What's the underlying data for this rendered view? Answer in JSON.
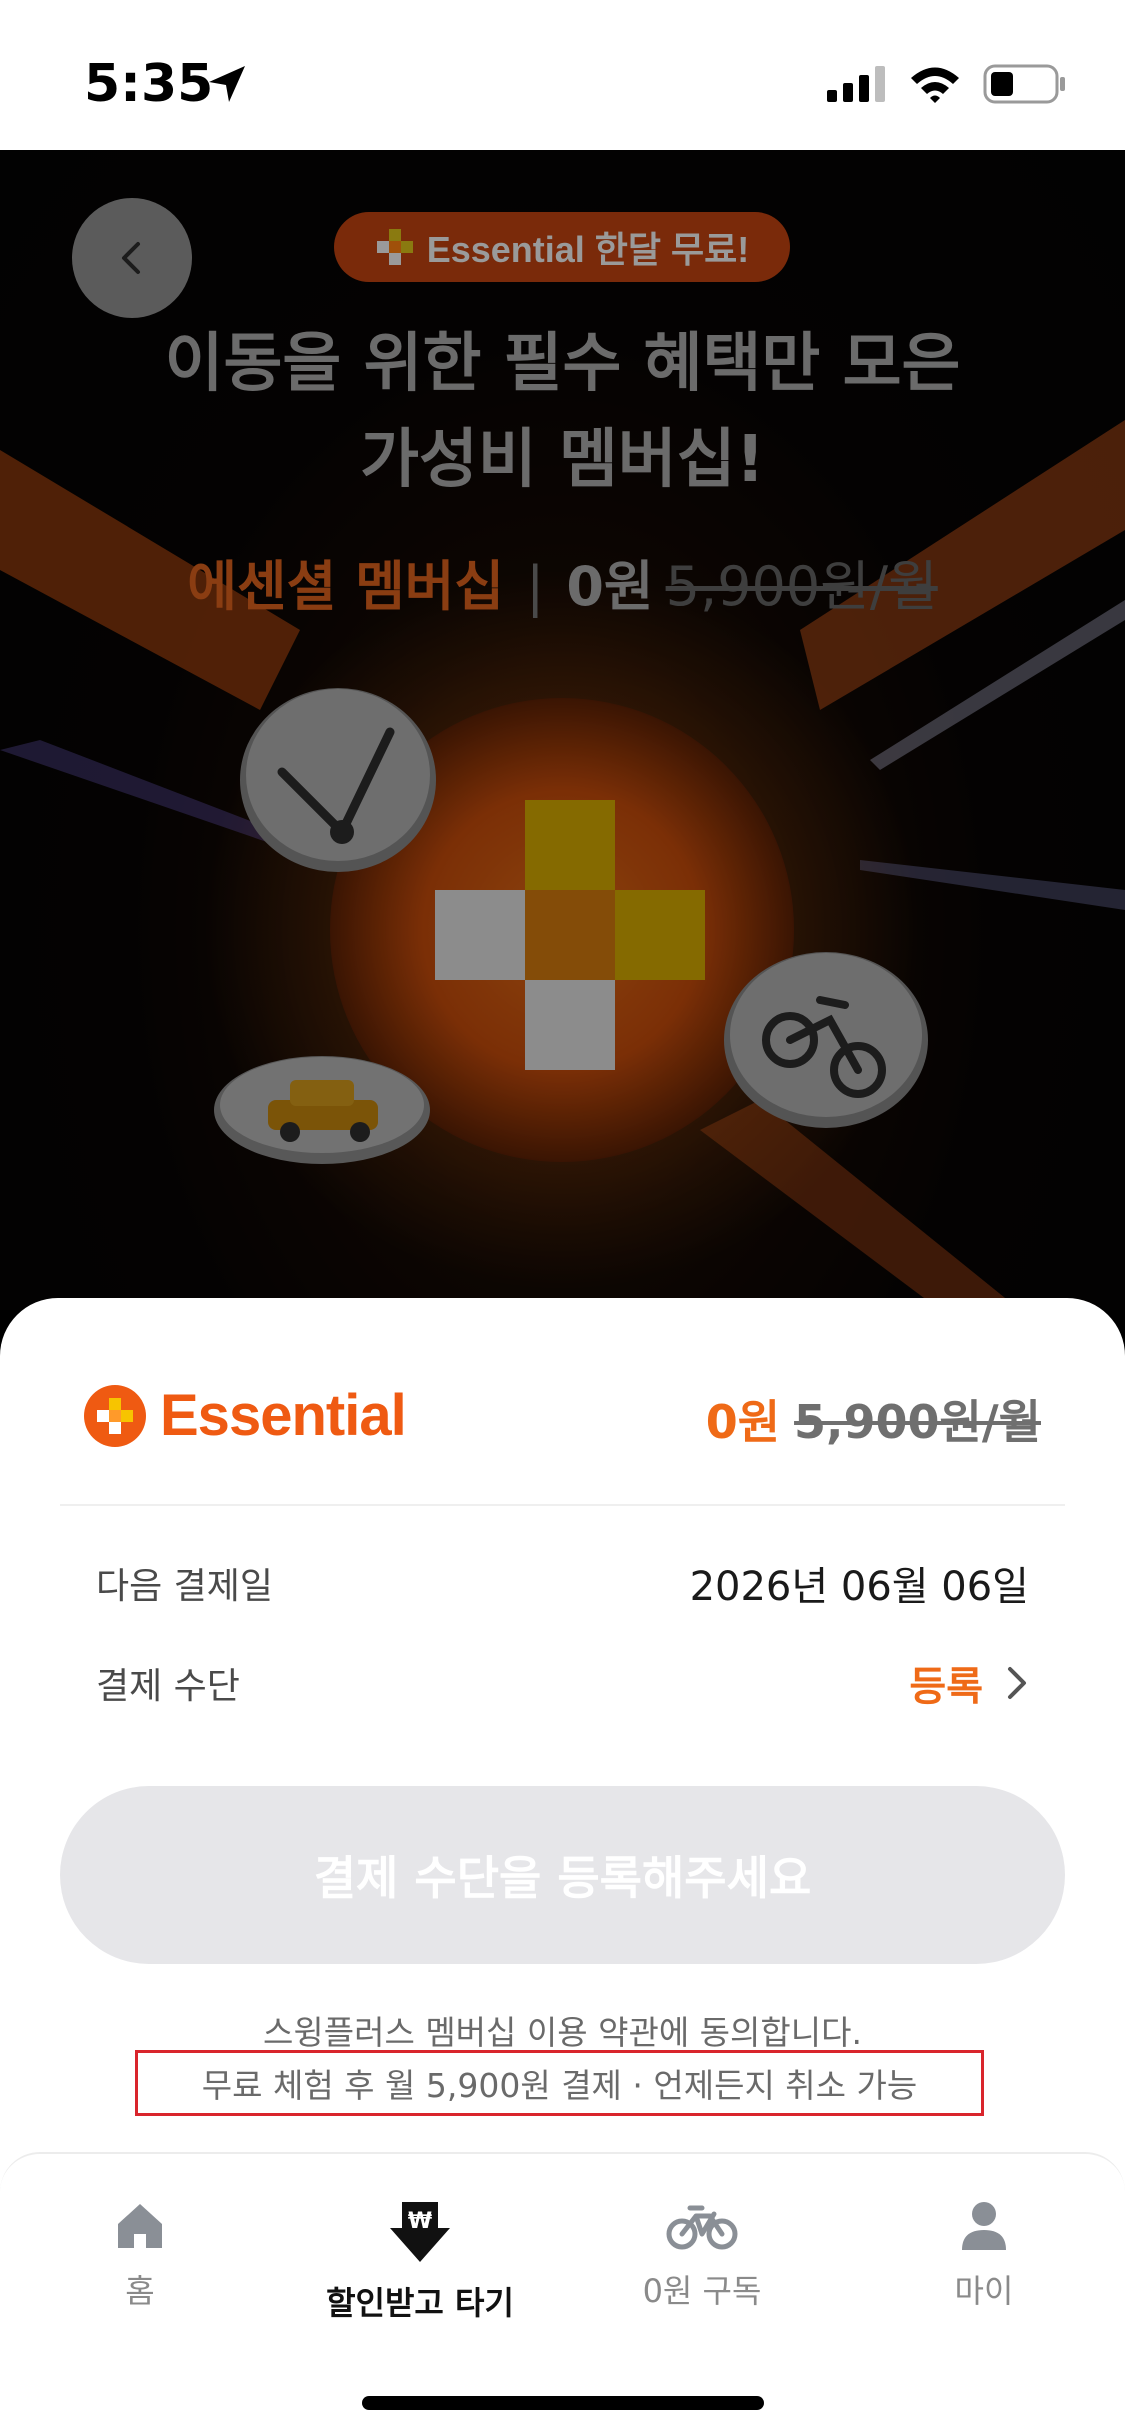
{
  "status_bar": {
    "time": "5:35"
  },
  "hero": {
    "promo_badge": "Essential 한달 무료!",
    "headline_line1": "이동을 위한 필수 혜택만 모은",
    "headline_line2": "가성비 멤버십!",
    "plan_name": "에센셜 멤버십",
    "separator": "|",
    "price_free": "0원",
    "price_original": "5,900원/월"
  },
  "sheet": {
    "brand_name": "Essential",
    "price_free": "0원",
    "price_original": "5,900원/월",
    "next_payment_label": "다음 결제일",
    "next_payment_value": "2026년 06월 06일",
    "payment_method_label": "결제 수단",
    "payment_method_action": "등록",
    "cta_label": "결제 수단을 등록해주세요",
    "terms_text": "스윙플러스 멤버십 이용 약관에 동의합니다.",
    "notice_text": "무료 체험 후 월 5,900원 결제 · 언제든지 취소 가능"
  },
  "tabbar": {
    "tabs": [
      {
        "label": "홈",
        "icon": "home-icon",
        "active": false
      },
      {
        "label": "할인받고 타기",
        "icon": "won-download-icon",
        "active": true
      },
      {
        "label": "0원 구독",
        "icon": "bicycle-icon",
        "active": false
      },
      {
        "label": "마이",
        "icon": "person-icon",
        "active": false
      }
    ]
  },
  "colors": {
    "accent": "#ef6a17",
    "notice_border": "#d9252c",
    "cta_disabled": "#e6e6e9"
  }
}
